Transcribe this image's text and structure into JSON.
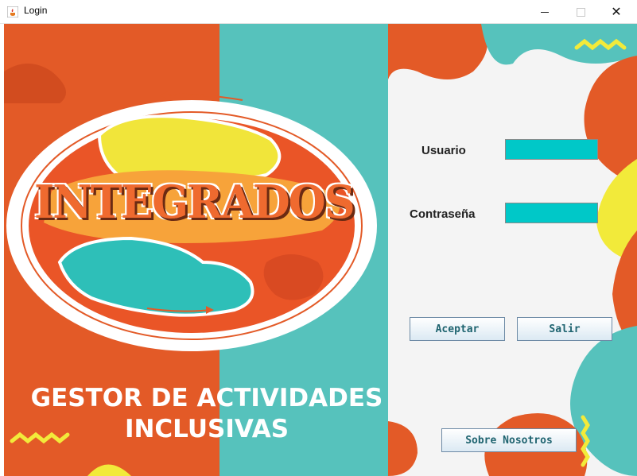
{
  "window": {
    "title": "Login"
  },
  "logo": {
    "text": "INTEGRADOS"
  },
  "banner": {
    "line1": "GESTOR DE ACTIVIDADES",
    "line2": "INCLUSIVAS"
  },
  "form": {
    "user_label": "Usuario",
    "user_value": "",
    "password_label": "Contraseña",
    "password_value": ""
  },
  "buttons": {
    "accept_label": "Aceptar",
    "exit_label": "Salir",
    "about_label": "Sobre Nosotros"
  },
  "colors": {
    "orange": "#e35a27",
    "teal": "#56c2bc",
    "field": "#00c8c8",
    "yellow": "#f2ea3a"
  }
}
